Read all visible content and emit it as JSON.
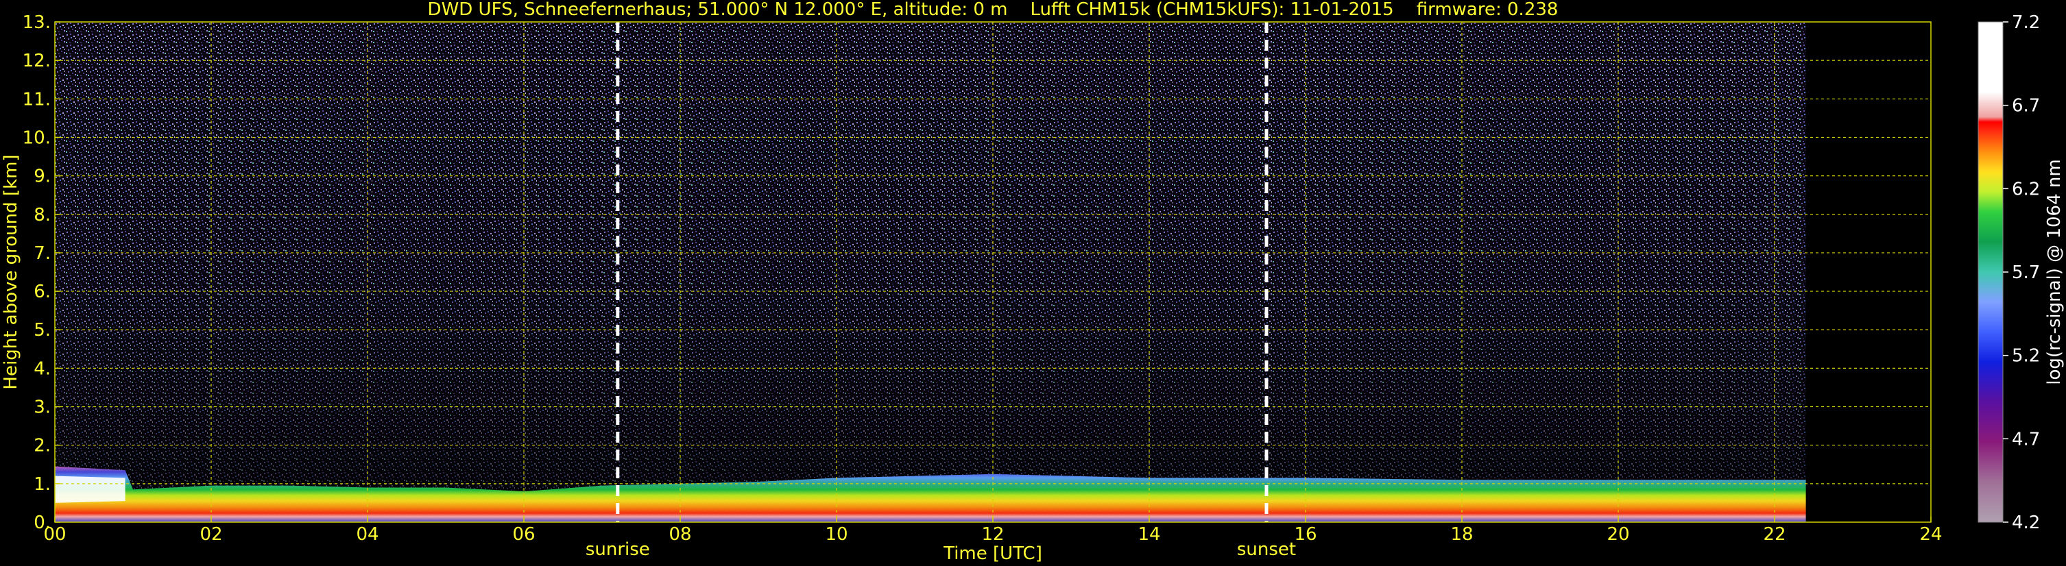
{
  "chart_data": {
    "type": "heatmap",
    "title": "DWD UFS, Schneefernerhaus; 51.000° N 12.000° E, altitude: 0 m    Lufft CHM15k (CHM15kUFS): 11-01-2015    firmware: 0.238",
    "xlabel": "Time [UTC]",
    "ylabel": "Height above ground [km]",
    "xlim": [
      0,
      24
    ],
    "ylim": [
      0,
      13
    ],
    "x_ticks": [
      "00",
      "02",
      "04",
      "06",
      "08",
      "10",
      "12",
      "14",
      "16",
      "18",
      "20",
      "22",
      "24"
    ],
    "y_ticks": [
      "0.",
      "1.",
      "2.",
      "3.",
      "4.",
      "5.",
      "6.",
      "7.",
      "8.",
      "9.",
      "10.",
      "11.",
      "12.",
      "13."
    ],
    "grid": true,
    "data_end_hour": 22.4,
    "markers": [
      {
        "label": "sunrise",
        "x": 7.2
      },
      {
        "label": "sunset",
        "x": 15.5
      }
    ],
    "colorbar": {
      "label": "log(rc-signal) @ 1064 nm",
      "range": [
        4.2,
        7.2
      ],
      "ticks": [
        "7.2",
        "6.7",
        "6.2",
        "5.7",
        "5.2",
        "4.7",
        "4.2"
      ]
    },
    "layer_top_km": [
      {
        "x": 0,
        "top": 1.45
      },
      {
        "x": 0.9,
        "top": 1.35
      },
      {
        "x": 1.0,
        "top": 0.85
      },
      {
        "x": 2.0,
        "top": 0.95
      },
      {
        "x": 3.0,
        "top": 0.95
      },
      {
        "x": 4.0,
        "top": 0.9
      },
      {
        "x": 5.0,
        "top": 0.9
      },
      {
        "x": 6.0,
        "top": 0.8
      },
      {
        "x": 7.0,
        "top": 0.95
      },
      {
        "x": 8.0,
        "top": 1.0
      },
      {
        "x": 9.0,
        "top": 1.05
      },
      {
        "x": 10.0,
        "top": 1.15
      },
      {
        "x": 11.0,
        "top": 1.2
      },
      {
        "x": 12.0,
        "top": 1.25
      },
      {
        "x": 13.0,
        "top": 1.2
      },
      {
        "x": 14.0,
        "top": 1.15
      },
      {
        "x": 16.0,
        "top": 1.15
      },
      {
        "x": 18.0,
        "top": 1.1
      },
      {
        "x": 20.0,
        "top": 1.1
      },
      {
        "x": 22.4,
        "top": 1.1
      }
    ],
    "colors": {
      "text": "#ffff33",
      "grid": "#d4d400",
      "marker": "#ffffff",
      "noise": "#6a5c9c"
    }
  }
}
